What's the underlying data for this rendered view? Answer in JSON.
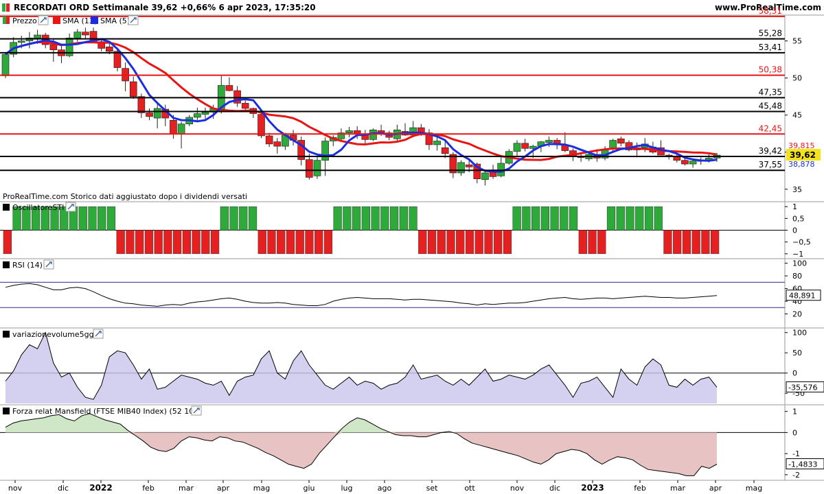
{
  "header": {
    "title": "RECORDATI ORD Settimanale 39,62 +0,66% 6 apr 2023, 17:35:20",
    "site": "www.ProRealTime.com"
  },
  "colors": {
    "up": "#2eaa3a",
    "down": "#e62020",
    "sma13": "#e81515",
    "sma5": "#1a2ee0",
    "level_black": "#000000",
    "level_red": "#e81515",
    "rsi_band": "#2a2a8a",
    "vol_fill": "#c9c6ec",
    "mansfield_pos": "#cfe7c7",
    "mansfield_neg": "#e7c3c3",
    "price_badge": "#f4e21a"
  },
  "panes": {
    "price": {
      "legend": [
        {
          "icon": "candle-icon",
          "label": "Prezzo"
        },
        {
          "icon": "red-square-icon",
          "label": "SMA (13)"
        },
        {
          "icon": "blue-square-icon",
          "label": "SMA (5)"
        }
      ],
      "note": "ProRealTime.com  Storico dati aggiustato dopo i dividendi versati",
      "badges": {
        "last": "39,62",
        "sma13": "39,815",
        "sma5": "38,878"
      }
    },
    "sti": {
      "legend": "OscillatoreSTI"
    },
    "rsi": {
      "legend": "RSI (14)",
      "badge": "48,891"
    },
    "vol": {
      "legend": "variazionevolume5gg",
      "badge": "-35,576"
    },
    "mansfield": {
      "legend": "Forza relat Mansfield (FTSE MIB40 Index) (52 10)",
      "badge": "-1,4833"
    }
  },
  "x_axis": [
    {
      "label": "nov",
      "bold": false
    },
    {
      "label": "dic",
      "bold": false
    },
    {
      "label": "2022",
      "bold": true
    },
    {
      "label": "feb",
      "bold": false
    },
    {
      "label": "mar",
      "bold": false
    },
    {
      "label": "apr",
      "bold": false
    },
    {
      "label": "mag",
      "bold": false
    },
    {
      "label": "giu",
      "bold": false
    },
    {
      "label": "lug",
      "bold": false
    },
    {
      "label": "ago",
      "bold": false
    },
    {
      "label": "set",
      "bold": false
    },
    {
      "label": "ott",
      "bold": false
    },
    {
      "label": "nov",
      "bold": false
    },
    {
      "label": "dic",
      "bold": false
    },
    {
      "label": "2023",
      "bold": true
    },
    {
      "label": "feb",
      "bold": false
    },
    {
      "label": "mar",
      "bold": false
    },
    {
      "label": "apr",
      "bold": false
    },
    {
      "label": "mag",
      "bold": false
    }
  ],
  "chart_data": [
    {
      "type": "candlestick",
      "title": "RECORDATI ORD Settimanale",
      "y_ticks": [
        35,
        40,
        45,
        50,
        55
      ],
      "ylim": [
        33.5,
        58.3
      ],
      "levels": [
        {
          "value": 58.31,
          "label": "58,31",
          "color": "red"
        },
        {
          "value": 55.28,
          "label": "55,28",
          "color": "black"
        },
        {
          "value": 53.41,
          "label": "53,41",
          "color": "black"
        },
        {
          "value": 50.38,
          "label": "50,38",
          "color": "red"
        },
        {
          "value": 47.35,
          "label": "47,35",
          "color": "black"
        },
        {
          "value": 45.48,
          "label": "45,48",
          "color": "black"
        },
        {
          "value": 42.45,
          "label": "42,45",
          "color": "red"
        },
        {
          "value": 39.42,
          "label": "39,42",
          "color": "black"
        },
        {
          "value": 37.55,
          "label": "37,55",
          "color": "black"
        }
      ],
      "candles": [
        [
          50.3,
          53.4,
          50.0,
          53.2
        ],
        [
          53.2,
          55.5,
          52.8,
          54.8
        ],
        [
          54.8,
          55.7,
          54.0,
          55.0
        ],
        [
          55.0,
          56.2,
          54.0,
          55.4
        ],
        [
          55.4,
          56.5,
          54.6,
          55.8
        ],
        [
          55.8,
          56.1,
          54.0,
          54.5
        ],
        [
          54.5,
          55.2,
          52.2,
          53.8
        ],
        [
          53.8,
          54.5,
          52.0,
          53.0
        ],
        [
          53.0,
          56.0,
          52.8,
          55.4
        ],
        [
          55.4,
          56.6,
          54.9,
          56.2
        ],
        [
          56.2,
          56.8,
          55.2,
          55.8
        ],
        [
          56.3,
          56.8,
          55.3,
          54.8
        ],
        [
          54.9,
          55.2,
          53.6,
          54.0
        ],
        [
          54.2,
          54.8,
          53.2,
          53.6
        ],
        [
          53.6,
          54.1,
          50.9,
          51.4
        ],
        [
          51.3,
          52.1,
          48.2,
          49.6
        ],
        [
          49.5,
          50.2,
          47.2,
          47.5
        ],
        [
          47.5,
          47.9,
          44.6,
          45.3
        ],
        [
          45.3,
          45.9,
          44.3,
          44.8
        ],
        [
          44.6,
          46.8,
          43.2,
          45.9
        ],
        [
          45.8,
          46.4,
          43.5,
          44.6
        ],
        [
          44.3,
          45.0,
          41.8,
          42.5
        ],
        [
          42.5,
          44.1,
          40.5,
          43.8
        ],
        [
          43.8,
          45.0,
          43.5,
          44.7
        ],
        [
          44.7,
          46.0,
          44.3,
          45.2
        ],
        [
          45.1,
          46.0,
          44.5,
          45.4
        ],
        [
          45.4,
          46.4,
          44.5,
          45.9
        ],
        [
          45.8,
          50.3,
          45.2,
          49.0
        ],
        [
          49.0,
          50.1,
          48.2,
          48.3
        ],
        [
          48.3,
          48.9,
          46.1,
          46.6
        ],
        [
          46.6,
          47.0,
          45.5,
          45.9
        ],
        [
          45.9,
          46.0,
          44.6,
          45.2
        ],
        [
          45.1,
          45.3,
          41.9,
          42.2
        ],
        [
          42.2,
          42.6,
          40.7,
          41.1
        ],
        [
          41.4,
          41.9,
          39.8,
          40.8
        ],
        [
          40.8,
          42.6,
          40.3,
          42.3
        ],
        [
          42.3,
          43.0,
          40.9,
          41.6
        ],
        [
          41.6,
          42.1,
          38.2,
          39.0
        ],
        [
          39.0,
          39.8,
          36.3,
          36.6
        ],
        [
          36.8,
          39.5,
          36.4,
          38.9
        ],
        [
          38.9,
          42.0,
          36.8,
          41.5
        ],
        [
          41.5,
          42.3,
          40.8,
          42.0
        ],
        [
          41.8,
          43.2,
          41.4,
          42.6
        ],
        [
          42.6,
          43.4,
          42.0,
          42.9
        ],
        [
          42.9,
          43.5,
          41.8,
          42.5
        ],
        [
          42.5,
          43.0,
          41.1,
          41.7
        ],
        [
          41.7,
          43.2,
          41.5,
          43.0
        ],
        [
          42.9,
          43.7,
          42.2,
          42.6
        ],
        [
          42.6,
          42.9,
          41.6,
          42.0
        ],
        [
          41.8,
          43.7,
          41.4,
          43.0
        ],
        [
          42.8,
          43.9,
          42.2,
          42.3
        ],
        [
          42.3,
          44.2,
          42.0,
          43.3
        ],
        [
          43.3,
          43.8,
          42.2,
          42.5
        ],
        [
          42.6,
          43.1,
          40.3,
          41.0
        ],
        [
          41.0,
          42.1,
          40.2,
          41.5
        ],
        [
          40.6,
          41.5,
          39.2,
          39.8
        ],
        [
          39.7,
          40.0,
          36.5,
          37.2
        ],
        [
          37.2,
          38.9,
          36.8,
          38.6
        ],
        [
          38.3,
          38.9,
          37.3,
          38.0
        ],
        [
          38.4,
          38.6,
          35.8,
          36.4
        ],
        [
          36.3,
          37.5,
          35.5,
          37.2
        ],
        [
          37.6,
          38.3,
          36.4,
          36.7
        ],
        [
          36.8,
          39.5,
          36.6,
          38.5
        ],
        [
          38.5,
          40.4,
          38.3,
          40.1
        ],
        [
          40.1,
          41.6,
          39.5,
          41.2
        ],
        [
          41.2,
          41.8,
          40.1,
          40.5
        ],
        [
          40.5,
          41.0,
          39.2,
          40.8
        ],
        [
          40.8,
          41.5,
          40.0,
          41.4
        ],
        [
          41.3,
          42.1,
          40.7,
          41.6
        ],
        [
          41.6,
          41.9,
          40.4,
          41.1
        ],
        [
          41.0,
          42.7,
          40.0,
          40.2
        ],
        [
          40.2,
          40.5,
          38.8,
          39.4
        ],
        [
          39.4,
          40.0,
          38.7,
          39.3
        ],
        [
          39.1,
          40.1,
          38.8,
          39.7
        ],
        [
          39.7,
          40.4,
          38.7,
          39.2
        ],
        [
          39.2,
          40.8,
          38.9,
          40.4
        ],
        [
          40.4,
          41.8,
          40.1,
          41.6
        ],
        [
          41.8,
          42.1,
          40.8,
          41.2
        ],
        [
          41.3,
          41.6,
          40.1,
          40.3
        ],
        [
          40.3,
          41.3,
          39.3,
          40.6
        ],
        [
          40.6,
          41.9,
          40.0,
          41.1
        ],
        [
          40.7,
          41.4,
          39.8,
          40.0
        ],
        [
          40.6,
          41.6,
          39.8,
          39.6
        ],
        [
          39.6,
          39.8,
          39.0,
          39.4
        ],
        [
          39.4,
          39.7,
          38.6,
          38.9
        ],
        [
          38.9,
          39.2,
          38.2,
          38.4
        ],
        [
          38.4,
          39.1,
          37.9,
          38.8
        ],
        [
          38.8,
          39.3,
          38.3,
          38.9
        ],
        [
          38.9,
          39.8,
          38.6,
          39.2
        ],
        [
          39.2,
          39.9,
          38.7,
          39.6
        ]
      ]
    },
    {
      "type": "bar",
      "title": "OscillatoreSTI",
      "y_ticks": [
        1,
        0.5,
        0,
        -0.5,
        -1
      ],
      "y_tick_labels": [
        "1",
        "0,5",
        "0",
        "−0,5",
        "−1"
      ],
      "ylim": [
        -1.15,
        1.15
      ],
      "values": [
        -1,
        1,
        1,
        1,
        1,
        1,
        1,
        1,
        1,
        1,
        1,
        1,
        -1,
        -1,
        -1,
        -1,
        -1,
        -1,
        -1,
        -1,
        -1,
        -1,
        -1,
        1,
        1,
        1,
        1,
        -1,
        -1,
        -1,
        -1,
        -1,
        -1,
        -1,
        -1,
        1,
        1,
        1,
        1,
        1,
        1,
        1,
        1,
        1,
        -1,
        -1,
        -1,
        -1,
        -1,
        -1,
        -1,
        -1,
        -1,
        -1,
        1,
        1,
        1,
        1,
        1,
        1,
        1,
        -1,
        -1,
        -1,
        1,
        1,
        1,
        1,
        1,
        1,
        -1,
        -1,
        -1,
        -1,
        -1,
        -1
      ]
    },
    {
      "type": "line",
      "title": "RSI (14)",
      "y_ticks": [
        100,
        80,
        60,
        40,
        20
      ],
      "ylim": [
        0,
        105
      ],
      "band": [
        70,
        30
      ],
      "values": [
        62,
        65,
        67,
        68,
        66,
        62,
        58,
        58,
        61,
        62,
        60,
        55,
        49,
        44,
        40,
        37,
        36,
        34,
        33,
        32,
        34,
        35,
        34,
        37,
        39,
        40,
        42,
        44,
        45,
        43,
        40,
        38,
        37,
        37,
        38,
        37,
        35,
        34,
        33,
        33,
        35,
        40,
        43,
        45,
        46,
        45,
        44,
        44,
        44,
        43,
        42,
        43,
        43,
        42,
        41,
        40,
        39,
        37,
        36,
        34,
        36,
        35,
        36,
        37,
        37,
        38,
        40,
        42,
        44,
        45,
        46,
        44,
        43,
        44,
        45,
        45,
        44,
        45,
        46,
        47,
        48,
        47,
        46,
        46,
        45,
        45,
        46,
        47,
        48,
        49
      ]
    },
    {
      "type": "area",
      "title": "variazionevolume5gg",
      "y_ticks": [
        100,
        50,
        0,
        -50
      ],
      "ylim": [
        -75,
        108
      ],
      "values": [
        -20,
        5,
        45,
        70,
        60,
        100,
        25,
        -10,
        0,
        -35,
        -60,
        -65,
        -30,
        40,
        55,
        50,
        20,
        -15,
        10,
        -40,
        -35,
        -20,
        -5,
        -10,
        -15,
        -25,
        -30,
        -20,
        -55,
        -20,
        -10,
        -5,
        35,
        55,
        0,
        -15,
        30,
        55,
        20,
        -5,
        -30,
        -40,
        -25,
        -10,
        -30,
        -20,
        -25,
        -40,
        -30,
        -25,
        -10,
        20,
        -15,
        -10,
        -5,
        -20,
        -30,
        -15,
        -30,
        -10,
        10,
        -20,
        -15,
        -5,
        -10,
        -15,
        -5,
        10,
        20,
        -5,
        -30,
        -60,
        -25,
        -20,
        -10,
        -35,
        -60,
        10,
        -15,
        -30,
        15,
        35,
        20,
        -30,
        -35,
        -15,
        -30,
        -15,
        -10,
        -35
      ]
    },
    {
      "type": "area",
      "title": "Forza relat Mansfield (FTSE MIB40 Index) (52 10)",
      "y_ticks": [
        1,
        0,
        -1,
        -2
      ],
      "ylim": [
        -2.2,
        1.25
      ],
      "values": [
        0.25,
        0.45,
        0.55,
        0.6,
        0.65,
        0.7,
        0.8,
        0.85,
        0.65,
        0.55,
        0.8,
        0.9,
        0.75,
        0.6,
        0.5,
        0.4,
        0.1,
        -0.15,
        -0.4,
        -0.7,
        -0.85,
        -0.9,
        -0.75,
        -0.4,
        -0.2,
        -0.25,
        -0.35,
        -0.4,
        -0.2,
        -0.25,
        -0.4,
        -0.45,
        -0.6,
        -0.75,
        -0.95,
        -1.1,
        -1.3,
        -1.5,
        -1.6,
        -1.7,
        -1.5,
        -1.0,
        -0.6,
        -0.2,
        0.2,
        0.5,
        0.7,
        0.6,
        0.4,
        0.2,
        0.05,
        -0.1,
        -0.15,
        -0.15,
        -0.2,
        -0.2,
        -0.1,
        0.0,
        0.05,
        -0.05,
        -0.3,
        -0.5,
        -0.6,
        -0.7,
        -0.8,
        -0.9,
        -1.0,
        -1.1,
        -1.25,
        -1.4,
        -1.5,
        -1.3,
        -1.0,
        -0.9,
        -0.8,
        -0.85,
        -1.0,
        -1.3,
        -1.5,
        -1.3,
        -1.15,
        -1.2,
        -1.3,
        -1.55,
        -1.75,
        -1.8,
        -1.85,
        -1.9,
        -1.95,
        -2.05,
        -2.05,
        -1.6,
        -1.7,
        -1.5
      ]
    }
  ]
}
